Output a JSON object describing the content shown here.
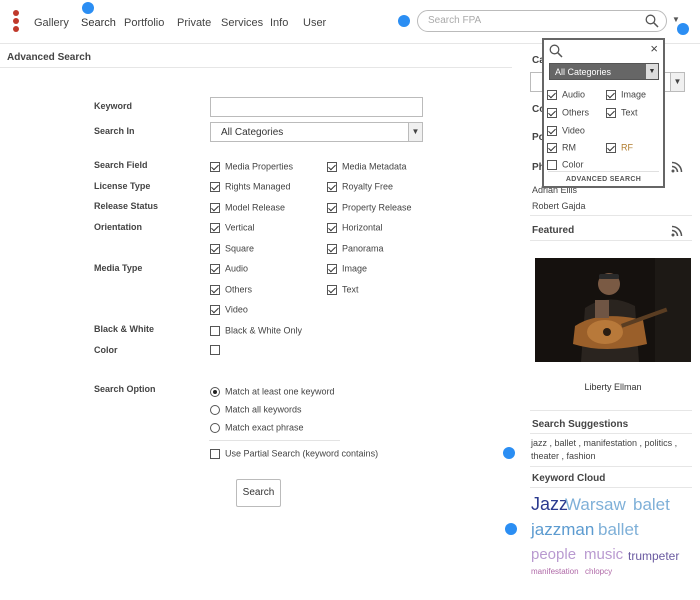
{
  "nav": {
    "items": [
      "Gallery",
      "Search",
      "Portfolio",
      "Private",
      "Services",
      "Info",
      "User"
    ],
    "search_placeholder": "Search FPA"
  },
  "advanced_search": {
    "heading": "Advanced Search",
    "keyword_label": "Keyword",
    "keyword_value": "",
    "search_in_label": "Search In",
    "search_in_value": "All Categories",
    "search_field_label": "Search Field",
    "search_field_options": [
      {
        "label": "Media Properties",
        "checked": true
      },
      {
        "label": "Media Metadata",
        "checked": true
      }
    ],
    "license_type_label": "License Type",
    "license_type_options": [
      {
        "label": "Rights Managed",
        "checked": true
      },
      {
        "label": "Royalty Free",
        "checked": true
      }
    ],
    "release_status_label": "Release Status",
    "release_status_options": [
      {
        "label": "Model Release",
        "checked": true
      },
      {
        "label": "Property Release",
        "checked": true
      }
    ],
    "orientation_label": "Orientation",
    "orientation_options": [
      {
        "label": "Vertical",
        "checked": true
      },
      {
        "label": "Horizontal",
        "checked": true
      },
      {
        "label": "Square",
        "checked": true
      },
      {
        "label": "Panorama",
        "checked": true
      }
    ],
    "media_type_label": "Media Type",
    "media_type_options": [
      {
        "label": "Audio",
        "checked": true
      },
      {
        "label": "Image",
        "checked": true
      },
      {
        "label": "Others",
        "checked": true
      },
      {
        "label": "Text",
        "checked": true
      },
      {
        "label": "Video",
        "checked": true
      }
    ],
    "bw_label": "Black & White",
    "bw_option": {
      "label": "Black & White Only",
      "checked": false
    },
    "color_label": "Color",
    "color_checked": false,
    "search_option_label": "Search Option",
    "search_options": [
      {
        "label": "Match at least one keyword",
        "selected": true
      },
      {
        "label": "Match all keywords",
        "selected": false
      },
      {
        "label": "Match exact phrase",
        "selected": false
      }
    ],
    "partial_search": {
      "label": "Use Partial Search (keyword contains)",
      "checked": false
    },
    "search_button": "Search"
  },
  "sidebar": {
    "cat_heading_fragment": "Ca",
    "co_fragment": "Co",
    "po_fragment": "Po",
    "ph_fragment": "Ph",
    "people": [
      "Adrian Ellis",
      "Robert Gajda"
    ],
    "featured_heading": "Featured",
    "featured_caption": "Liberty Ellman",
    "suggestions_heading": "Search Suggestions",
    "suggestions_text": "jazz , ballet , manifestation , politics , theater , fashion",
    "cloud_heading": "Keyword Cloud",
    "cloud_words": [
      {
        "word": "Jazz",
        "color": "#2b3a8f"
      },
      {
        "word": "Warsaw",
        "color": "#7fb0d8"
      },
      {
        "word": "balet",
        "color": "#7fb0d8"
      },
      {
        "word": "jazzman",
        "color": "#5c9bd0"
      },
      {
        "word": "ballet",
        "color": "#7fb0d8"
      },
      {
        "word": "people",
        "color": "#b99ad0"
      },
      {
        "word": "music",
        "color": "#b99ad0"
      },
      {
        "word": "trumpeter",
        "color": "#6a5aa0"
      },
      {
        "word": "manifestation",
        "color": "#b06aa8"
      },
      {
        "word": "chlopcy",
        "color": "#b06aa8"
      }
    ]
  },
  "popup": {
    "category_value": "All Categories",
    "options": [
      {
        "label": "Audio",
        "checked": true
      },
      {
        "label": "Image",
        "checked": true
      },
      {
        "label": "Others",
        "checked": true
      },
      {
        "label": "Text",
        "checked": true
      },
      {
        "label": "Video",
        "checked": true
      },
      {
        "label": "RM",
        "checked": true
      },
      {
        "label": "RF",
        "checked": true
      },
      {
        "label": "Color",
        "checked": false
      }
    ],
    "advanced_link": "ADVANCED SEARCH"
  },
  "icons": [
    "kebab-menu-icon",
    "search-icon",
    "caret-down-icon",
    "close-icon",
    "rss-icon"
  ],
  "colors": {
    "accent_dot": "#2b8ef3",
    "kebab": "#c0392b",
    "rf_text": "#b07b2c"
  }
}
